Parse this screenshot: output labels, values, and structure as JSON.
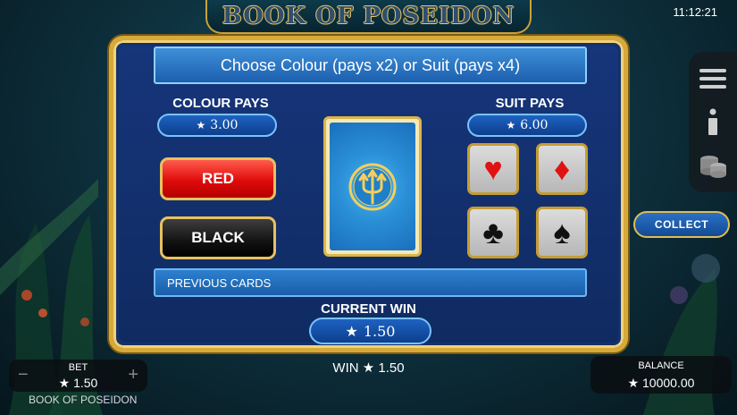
{
  "header": {
    "logo_text": "BOOK OF POSEIDON",
    "clock": "11:12:21"
  },
  "gamble": {
    "title": "Choose Colour (pays x2) or Suit (pays x4)",
    "colour_pays_label": "COLOUR PAYS",
    "colour_pays_value": "3.00",
    "suit_pays_label": "SUIT PAYS",
    "suit_pays_value": "6.00",
    "red_label": "RED",
    "black_label": "BLACK",
    "suits": {
      "hearts": "♥",
      "diamonds": "♦",
      "clubs": "♣",
      "spades": "♠"
    },
    "previous_cards_label": "PREVIOUS CARDS",
    "current_win_label": "CURRENT WIN",
    "current_win_value": "1.50",
    "star": "★"
  },
  "side": {
    "collect_label": "COLLECT",
    "icons": [
      "menu-icon",
      "info-icon",
      "coins-icon"
    ]
  },
  "footer": {
    "bet_label": "BET",
    "bet_value": "★ 1.50",
    "minus": "−",
    "plus": "+",
    "game_name": "BOOK OF POSEIDON",
    "win_text": "WIN ★ 1.50",
    "balance_label": "BALANCE",
    "balance_value": "★ 10000.00"
  },
  "colors": {
    "gold": "#d6aa3a",
    "panel": "#14316b",
    "red": "#e00b0b"
  }
}
